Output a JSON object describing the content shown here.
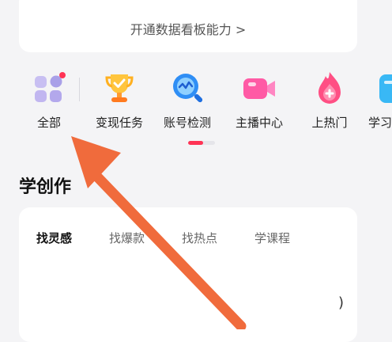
{
  "dashboard_card": {
    "link_text": "开通数据看板能力 >"
  },
  "quick_actions": [
    {
      "label": "全部",
      "icon": "grid-icon",
      "has_badge": true
    },
    {
      "label": "变现任务",
      "icon": "trophy-icon"
    },
    {
      "label": "账号检测",
      "icon": "chart-search-icon"
    },
    {
      "label": "主播中心",
      "icon": "video-camera-icon"
    },
    {
      "label": "上热门",
      "icon": "flame-plus-icon"
    },
    {
      "label": "学习",
      "icon": "book-icon"
    }
  ],
  "scroll_indicator": {
    "progress": 0.55
  },
  "create_section": {
    "title": "学创作",
    "tabs": [
      "找灵感",
      "找爆款",
      "找热点",
      "学课程"
    ],
    "active_tab_index": 0
  },
  "stray_text": ")",
  "annotation": {
    "type": "arrow",
    "color": "#f06b3c",
    "points_to": "全部"
  },
  "colors": {
    "accent": "#ff3355",
    "background": "#f4f4f6",
    "card": "#ffffff"
  }
}
